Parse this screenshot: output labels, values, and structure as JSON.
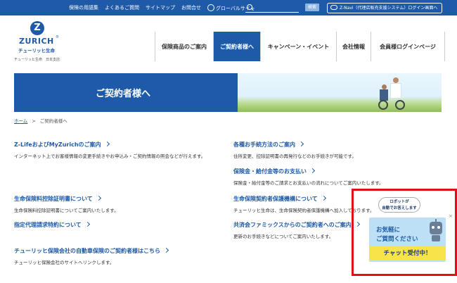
{
  "topbar": {
    "links": [
      "保険の用語集",
      "よくあるご質問",
      "サイトマップ",
      "お問合せ",
      "グローバルサイト"
    ],
    "search_button": "検索",
    "znavi": "Z-Navi（代理店販売支援システム）ログイン画面へ"
  },
  "logo": {
    "mark": "Z",
    "wordmark": "ZURICH",
    "registered": "®",
    "company": "チューリッヒ生命",
    "branch": "チューリッヒ生命　日本支店"
  },
  "nav": {
    "items": [
      "保険商品のご案内",
      "ご契約者様へ",
      "キャンペーン・イベント",
      "会社情報",
      "会員様ログインページ"
    ],
    "active_index": 1
  },
  "banner": {
    "title": "ご契約者様へ"
  },
  "breadcrumb": {
    "home": "ホーム",
    "separator": ">",
    "current": "ご契約者様へ"
  },
  "entries": [
    {
      "title": "Z-LifeおよびMyZurichのご案内",
      "desc": "インターネット上でお客様情報の変更手続きやお申込み・ご契約情報の照会などが行えます。"
    },
    {
      "title": "生命保険料控除証明書について",
      "desc": "生命保険料控除証明書についてご案内いたします。"
    },
    {
      "title": "指定代理請求特約について",
      "desc": ""
    },
    {
      "title": "チューリッヒ保険会社の自動車保険のご契約者様はこちら",
      "desc": "チューリッヒ保険会社のサイトへリンクします。"
    },
    {
      "title": "各種お手続方法のご案内",
      "desc": "住所変更、控除証明書の再発行などのお手続きが可能です。"
    },
    {
      "title": "保険金・給付金等のお支払い",
      "desc": "保険金・給付金等のご請求とお支払いの流れについてご案内いたします。"
    },
    {
      "title": "生命保険契約者保護機構について",
      "desc": "チューリッヒ生命は、生命保険契約者保護機構へ加入しております。"
    },
    {
      "title": "共済会ファミックスからのご契約者へのご案内",
      "desc": "更新のお手続きなどについてご案内いたします。"
    }
  ],
  "chat": {
    "bubble": "ロボットが\n自動でお答えします",
    "line1": "お気軽に",
    "line2": "ご質問ください",
    "cta": "チャット受付中！",
    "close": "×"
  },
  "colors": {
    "brand_blue": "#1e5aa8",
    "chat_bg": "#bde0f6",
    "cta_yellow": "#f6e44a",
    "highlight_red": "#e0101b"
  }
}
